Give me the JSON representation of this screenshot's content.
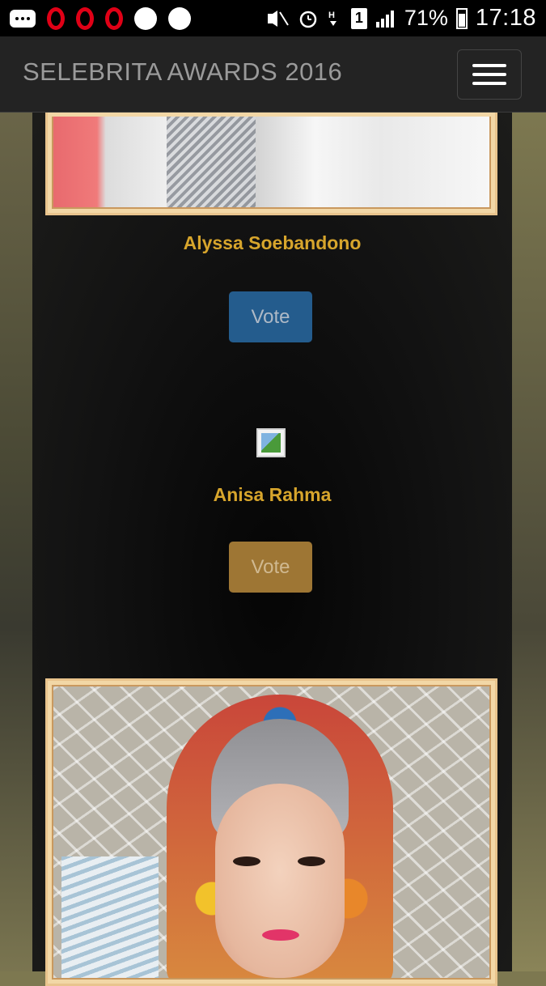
{
  "status_bar": {
    "battery": "71%",
    "time": "17:18",
    "sim": "1",
    "icons": [
      "more-icon",
      "opera-icon",
      "opera-icon",
      "opera-icon",
      "messenger-icon",
      "telegram-icon",
      "mute-icon",
      "alarm-icon",
      "data-icon",
      "sim-icon",
      "signal-icon",
      "battery-icon"
    ]
  },
  "navbar": {
    "brand": "SELEBRITA AWARDS 2016",
    "menu_icon": "hamburger-icon"
  },
  "nominees": [
    {
      "name": "Alyssa Soebandono",
      "vote_label": "Vote",
      "button_color": "#245c8d"
    },
    {
      "name": "Anisa Rahma",
      "vote_label": "Vote",
      "button_color": "#9e7634"
    }
  ],
  "colors": {
    "accent_name": "#d7a52c",
    "frame": "#e9c48d"
  }
}
